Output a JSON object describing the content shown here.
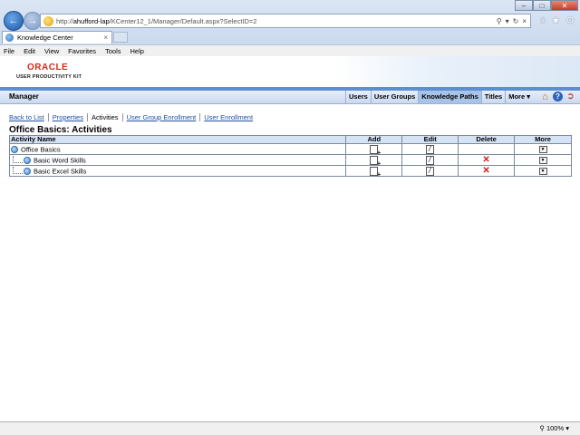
{
  "browser": {
    "url_prefix": "http://",
    "url_host": "ahufford-lap",
    "url_path": "/KCenter12_1/Manager/Default.aspx?SelectID=2",
    "tab_title": "Knowledge Center",
    "menu": [
      "File",
      "Edit",
      "View",
      "Favorites",
      "Tools",
      "Help"
    ],
    "zoom": "100%"
  },
  "banner": {
    "logo_word": "ORACLE",
    "logo_sub": "USER PRODUCTIVITY KIT"
  },
  "navbar": {
    "section": "Manager",
    "tabs": [
      "Users",
      "User Groups",
      "Knowledge Paths",
      "Titles",
      "More ▾"
    ],
    "active_tab": "Knowledge Paths"
  },
  "subnav": {
    "links": [
      "Back to List",
      "Properties",
      "Activities",
      "User Group Enrollment",
      "User Enrollment"
    ],
    "current": "Activities"
  },
  "page": {
    "title": "Office Basics: Activities"
  },
  "table": {
    "headers": {
      "name": "Activity Name",
      "add": "Add",
      "edit": "Edit",
      "delete": "Delete",
      "more": "More"
    },
    "rows": [
      {
        "name": "Office Basics",
        "indent": false,
        "deletable": false
      },
      {
        "name": "Basic Word Skills",
        "indent": true,
        "deletable": true
      },
      {
        "name": "Basic Excel Skills",
        "indent": true,
        "deletable": true
      }
    ]
  },
  "icons": {
    "add": "add-icon",
    "edit": "edit-icon",
    "delete": "delete-icon",
    "more": "dropdown-icon",
    "home": "home-icon",
    "help": "help-icon",
    "logout": "logout-icon"
  },
  "colors": {
    "accent": "#5b8fd1",
    "link": "#1f4fa0",
    "oracle_red": "#d42a1c",
    "delete_red": "#d32020"
  }
}
